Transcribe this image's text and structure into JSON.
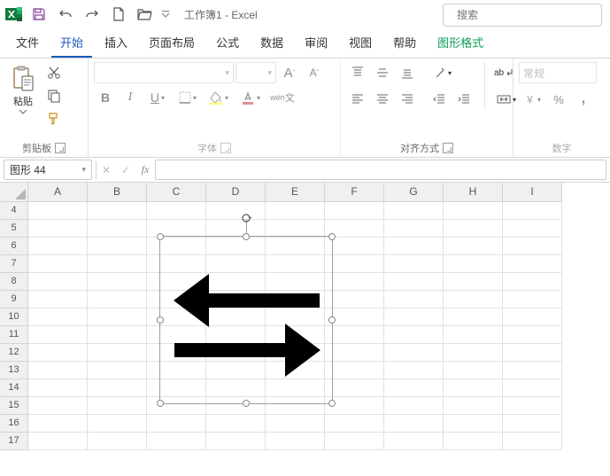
{
  "app": {
    "title": "工作簿1 - Excel"
  },
  "search": {
    "placeholder": "搜索"
  },
  "tabs": {
    "file": "文件",
    "home": "开始",
    "insert": "插入",
    "layout": "页面布局",
    "formulas": "公式",
    "data": "数据",
    "review": "审阅",
    "view": "视图",
    "help": "帮助",
    "shapefmt": "图形格式"
  },
  "ribbon": {
    "clipboard": {
      "paste": "粘贴",
      "label": "剪贴板"
    },
    "font": {
      "bold": "B",
      "italic": "I",
      "underline": "U",
      "label": "字体",
      "sizeUpA": "A",
      "sizeDownA": "A",
      "wen": "wén",
      "wen2": "文"
    },
    "align": {
      "label": "对齐方式",
      "ab": "ab"
    },
    "number": {
      "label": "数字",
      "general": "常规",
      "pct": "%",
      "comma": ","
    }
  },
  "namebox": {
    "value": "图形 44",
    "fx": "fx"
  },
  "grid": {
    "cols": [
      "A",
      "B",
      "C",
      "D",
      "E",
      "F",
      "G",
      "H",
      "I"
    ],
    "rows": [
      "4",
      "5",
      "6",
      "7",
      "8",
      "9",
      "10",
      "11",
      "12",
      "13",
      "14",
      "15",
      "16",
      "17"
    ]
  }
}
